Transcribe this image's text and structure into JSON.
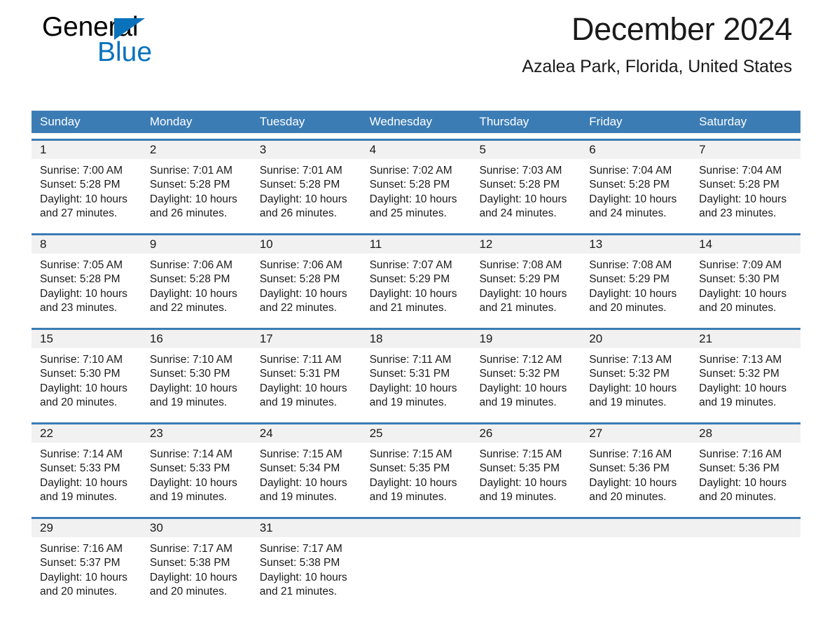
{
  "brand": {
    "name_part1": "General",
    "name_part2": "Blue",
    "accent_color": "#0a72bb"
  },
  "header": {
    "title": "December 2024",
    "location": "Azalea Park, Florida, United States"
  },
  "theme": {
    "header_blue": "#3b7cb5",
    "date_band_gray": "#f1f1f1",
    "text_color": "#1a1a1a"
  },
  "weekdays": [
    "Sunday",
    "Monday",
    "Tuesday",
    "Wednesday",
    "Thursday",
    "Friday",
    "Saturday"
  ],
  "labels": {
    "sunrise_prefix": "Sunrise:",
    "sunset_prefix": "Sunset:",
    "daylight_prefix": "Daylight:"
  },
  "weeks": [
    {
      "days": [
        {
          "date": "1",
          "sunrise": "Sunrise: 7:00 AM",
          "sunset": "Sunset: 5:28 PM",
          "daylight_line1": "Daylight: 10 hours",
          "daylight_line2": "and 27 minutes."
        },
        {
          "date": "2",
          "sunrise": "Sunrise: 7:01 AM",
          "sunset": "Sunset: 5:28 PM",
          "daylight_line1": "Daylight: 10 hours",
          "daylight_line2": "and 26 minutes."
        },
        {
          "date": "3",
          "sunrise": "Sunrise: 7:01 AM",
          "sunset": "Sunset: 5:28 PM",
          "daylight_line1": "Daylight: 10 hours",
          "daylight_line2": "and 26 minutes."
        },
        {
          "date": "4",
          "sunrise": "Sunrise: 7:02 AM",
          "sunset": "Sunset: 5:28 PM",
          "daylight_line1": "Daylight: 10 hours",
          "daylight_line2": "and 25 minutes."
        },
        {
          "date": "5",
          "sunrise": "Sunrise: 7:03 AM",
          "sunset": "Sunset: 5:28 PM",
          "daylight_line1": "Daylight: 10 hours",
          "daylight_line2": "and 24 minutes."
        },
        {
          "date": "6",
          "sunrise": "Sunrise: 7:04 AM",
          "sunset": "Sunset: 5:28 PM",
          "daylight_line1": "Daylight: 10 hours",
          "daylight_line2": "and 24 minutes."
        },
        {
          "date": "7",
          "sunrise": "Sunrise: 7:04 AM",
          "sunset": "Sunset: 5:28 PM",
          "daylight_line1": "Daylight: 10 hours",
          "daylight_line2": "and 23 minutes."
        }
      ]
    },
    {
      "days": [
        {
          "date": "8",
          "sunrise": "Sunrise: 7:05 AM",
          "sunset": "Sunset: 5:28 PM",
          "daylight_line1": "Daylight: 10 hours",
          "daylight_line2": "and 23 minutes."
        },
        {
          "date": "9",
          "sunrise": "Sunrise: 7:06 AM",
          "sunset": "Sunset: 5:28 PM",
          "daylight_line1": "Daylight: 10 hours",
          "daylight_line2": "and 22 minutes."
        },
        {
          "date": "10",
          "sunrise": "Sunrise: 7:06 AM",
          "sunset": "Sunset: 5:28 PM",
          "daylight_line1": "Daylight: 10 hours",
          "daylight_line2": "and 22 minutes."
        },
        {
          "date": "11",
          "sunrise": "Sunrise: 7:07 AM",
          "sunset": "Sunset: 5:29 PM",
          "daylight_line1": "Daylight: 10 hours",
          "daylight_line2": "and 21 minutes."
        },
        {
          "date": "12",
          "sunrise": "Sunrise: 7:08 AM",
          "sunset": "Sunset: 5:29 PM",
          "daylight_line1": "Daylight: 10 hours",
          "daylight_line2": "and 21 minutes."
        },
        {
          "date": "13",
          "sunrise": "Sunrise: 7:08 AM",
          "sunset": "Sunset: 5:29 PM",
          "daylight_line1": "Daylight: 10 hours",
          "daylight_line2": "and 20 minutes."
        },
        {
          "date": "14",
          "sunrise": "Sunrise: 7:09 AM",
          "sunset": "Sunset: 5:30 PM",
          "daylight_line1": "Daylight: 10 hours",
          "daylight_line2": "and 20 minutes."
        }
      ]
    },
    {
      "days": [
        {
          "date": "15",
          "sunrise": "Sunrise: 7:10 AM",
          "sunset": "Sunset: 5:30 PM",
          "daylight_line1": "Daylight: 10 hours",
          "daylight_line2": "and 20 minutes."
        },
        {
          "date": "16",
          "sunrise": "Sunrise: 7:10 AM",
          "sunset": "Sunset: 5:30 PM",
          "daylight_line1": "Daylight: 10 hours",
          "daylight_line2": "and 19 minutes."
        },
        {
          "date": "17",
          "sunrise": "Sunrise: 7:11 AM",
          "sunset": "Sunset: 5:31 PM",
          "daylight_line1": "Daylight: 10 hours",
          "daylight_line2": "and 19 minutes."
        },
        {
          "date": "18",
          "sunrise": "Sunrise: 7:11 AM",
          "sunset": "Sunset: 5:31 PM",
          "daylight_line1": "Daylight: 10 hours",
          "daylight_line2": "and 19 minutes."
        },
        {
          "date": "19",
          "sunrise": "Sunrise: 7:12 AM",
          "sunset": "Sunset: 5:32 PM",
          "daylight_line1": "Daylight: 10 hours",
          "daylight_line2": "and 19 minutes."
        },
        {
          "date": "20",
          "sunrise": "Sunrise: 7:13 AM",
          "sunset": "Sunset: 5:32 PM",
          "daylight_line1": "Daylight: 10 hours",
          "daylight_line2": "and 19 minutes."
        },
        {
          "date": "21",
          "sunrise": "Sunrise: 7:13 AM",
          "sunset": "Sunset: 5:32 PM",
          "daylight_line1": "Daylight: 10 hours",
          "daylight_line2": "and 19 minutes."
        }
      ]
    },
    {
      "days": [
        {
          "date": "22",
          "sunrise": "Sunrise: 7:14 AM",
          "sunset": "Sunset: 5:33 PM",
          "daylight_line1": "Daylight: 10 hours",
          "daylight_line2": "and 19 minutes."
        },
        {
          "date": "23",
          "sunrise": "Sunrise: 7:14 AM",
          "sunset": "Sunset: 5:33 PM",
          "daylight_line1": "Daylight: 10 hours",
          "daylight_line2": "and 19 minutes."
        },
        {
          "date": "24",
          "sunrise": "Sunrise: 7:15 AM",
          "sunset": "Sunset: 5:34 PM",
          "daylight_line1": "Daylight: 10 hours",
          "daylight_line2": "and 19 minutes."
        },
        {
          "date": "25",
          "sunrise": "Sunrise: 7:15 AM",
          "sunset": "Sunset: 5:35 PM",
          "daylight_line1": "Daylight: 10 hours",
          "daylight_line2": "and 19 minutes."
        },
        {
          "date": "26",
          "sunrise": "Sunrise: 7:15 AM",
          "sunset": "Sunset: 5:35 PM",
          "daylight_line1": "Daylight: 10 hours",
          "daylight_line2": "and 19 minutes."
        },
        {
          "date": "27",
          "sunrise": "Sunrise: 7:16 AM",
          "sunset": "Sunset: 5:36 PM",
          "daylight_line1": "Daylight: 10 hours",
          "daylight_line2": "and 20 minutes."
        },
        {
          "date": "28",
          "sunrise": "Sunrise: 7:16 AM",
          "sunset": "Sunset: 5:36 PM",
          "daylight_line1": "Daylight: 10 hours",
          "daylight_line2": "and 20 minutes."
        }
      ]
    },
    {
      "days": [
        {
          "date": "29",
          "sunrise": "Sunrise: 7:16 AM",
          "sunset": "Sunset: 5:37 PM",
          "daylight_line1": "Daylight: 10 hours",
          "daylight_line2": "and 20 minutes."
        },
        {
          "date": "30",
          "sunrise": "Sunrise: 7:17 AM",
          "sunset": "Sunset: 5:38 PM",
          "daylight_line1": "Daylight: 10 hours",
          "daylight_line2": "and 20 minutes."
        },
        {
          "date": "31",
          "sunrise": "Sunrise: 7:17 AM",
          "sunset": "Sunset: 5:38 PM",
          "daylight_line1": "Daylight: 10 hours",
          "daylight_line2": "and 21 minutes."
        },
        {
          "date": "",
          "sunrise": "",
          "sunset": "",
          "daylight_line1": "",
          "daylight_line2": ""
        },
        {
          "date": "",
          "sunrise": "",
          "sunset": "",
          "daylight_line1": "",
          "daylight_line2": ""
        },
        {
          "date": "",
          "sunrise": "",
          "sunset": "",
          "daylight_line1": "",
          "daylight_line2": ""
        },
        {
          "date": "",
          "sunrise": "",
          "sunset": "",
          "daylight_line1": "",
          "daylight_line2": ""
        }
      ]
    }
  ]
}
